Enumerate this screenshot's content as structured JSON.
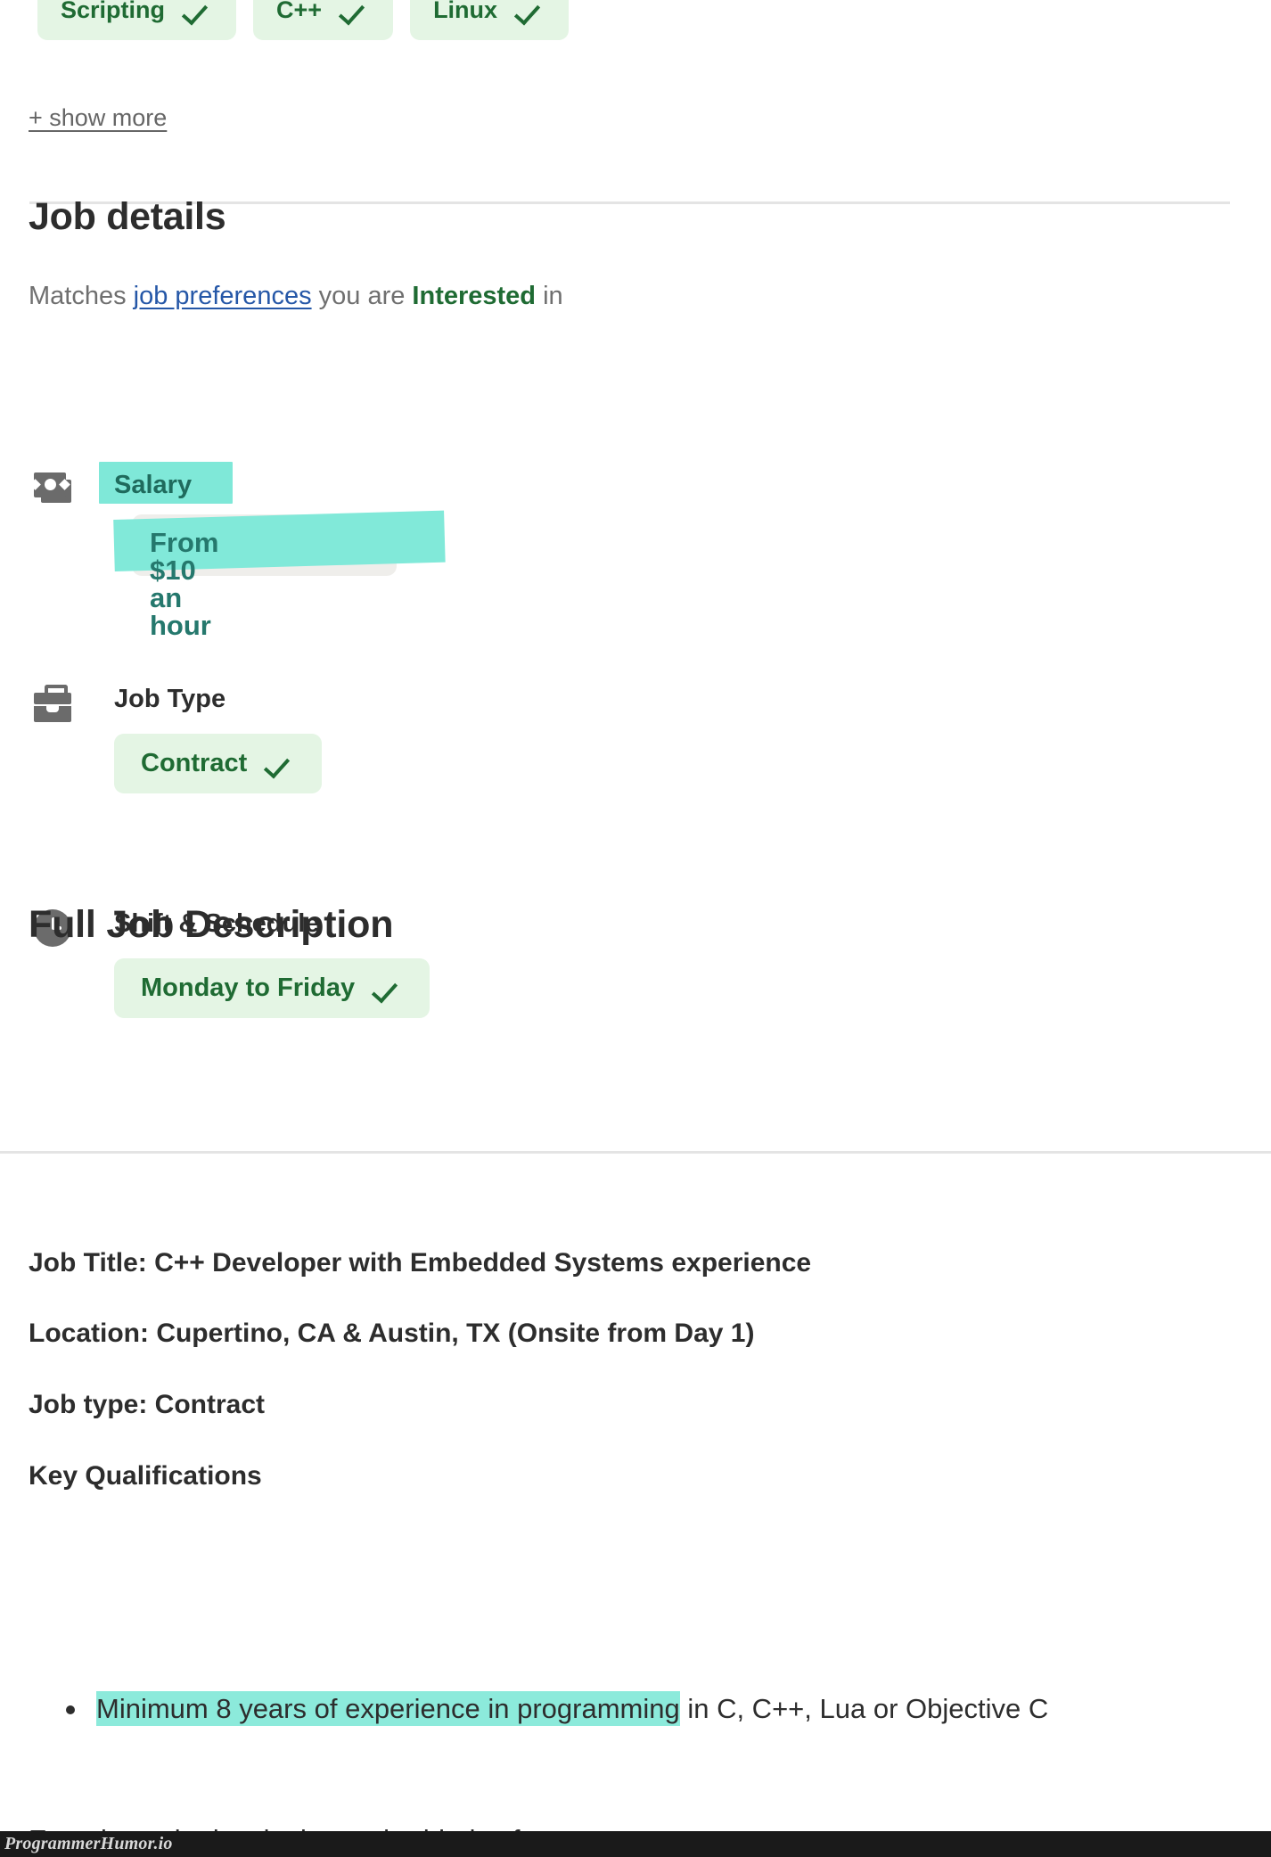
{
  "skills": {
    "chips": [
      {
        "label": "Scripting",
        "icon": "check-icon"
      },
      {
        "label": "C++",
        "icon": "check-icon"
      },
      {
        "label": "Linux",
        "icon": "check-icon"
      }
    ],
    "show_more_label": "+ show more"
  },
  "job_details": {
    "heading": "Job details",
    "matches": {
      "prefix": "Matches ",
      "link": "job preferences",
      "middle": " you are ",
      "emphasis": "Interested",
      "suffix": " in"
    },
    "rows": [
      {
        "icon": "money-icon",
        "title": "Salary",
        "value": "From $10 an hour",
        "highlighted": true
      },
      {
        "icon": "briefcase-icon",
        "title": "Job Type",
        "value": "Contract",
        "value_icon": "check-icon",
        "highlighted": false
      },
      {
        "icon": "clock-icon",
        "title": "Shift & Schedule",
        "value": "Monday to Friday",
        "value_icon": "check-icon",
        "highlighted": false
      }
    ]
  },
  "full_description": {
    "heading": "Full Job Description",
    "lines": [
      "Job Title: C++ Developer with Embedded Systems experience",
      "Location: Cupertino, CA & Austin, TX (Onsite from Day 1)",
      "Job type: Contract",
      "Key Qualifications"
    ],
    "bullets": [
      {
        "highlight": "Minimum 8 years of experience in programming",
        "rest": " in C, C++, Lua or Objective C"
      }
    ],
    "clipped_next_line": "Experience in developing embedded software"
  },
  "watermark": {
    "text": "ProgrammerHumor.io"
  },
  "colors": {
    "chip_bg": "#e4f5e4",
    "chip_text": "#1f6b33",
    "highlight_cyan": "#7fe8d8",
    "highlight_cyan_strong": "#8ceadb",
    "grey_pill": "#efeeeb",
    "link_blue": "#2557a7",
    "body_text": "#2d2d2d",
    "muted_text": "#6f6f6f",
    "icon_grey": "#6b6b6b",
    "divider": "#e4e4e4",
    "watermark_bar": "#1a1a1a"
  }
}
